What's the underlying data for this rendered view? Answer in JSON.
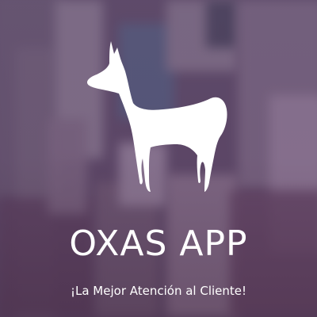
{
  "app": {
    "name": "OXAS APP",
    "tagline": "¡La Mejor Atención al Cliente!"
  },
  "logo": {
    "icon": "llama-icon",
    "color": "#ffffff"
  },
  "background": {
    "description_color": "#5b4a64",
    "accent": "#8a6f8f"
  }
}
